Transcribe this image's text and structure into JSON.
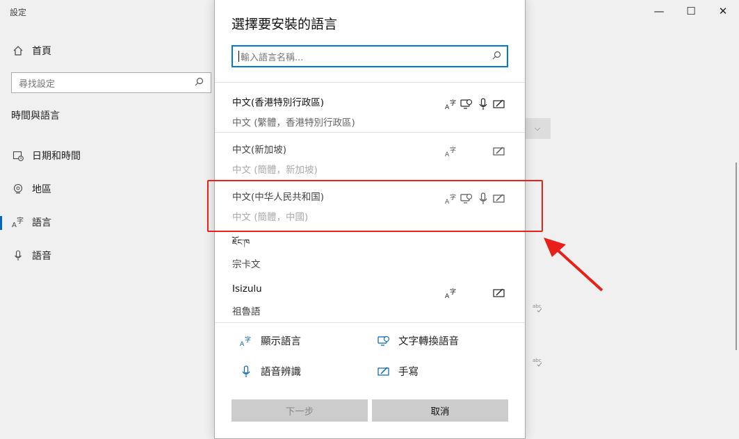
{
  "window": {
    "title": "設定",
    "minimize_glyph": "—",
    "maximize_glyph": "☐",
    "close_glyph": "✕"
  },
  "sidebar": {
    "home_label": "首頁",
    "search_placeholder": "尋找設定",
    "section_title": "時間與語言",
    "items": [
      {
        "label": "日期和時間",
        "icon": "calendar-clock-icon"
      },
      {
        "label": "地區",
        "icon": "globe-icon"
      },
      {
        "label": "語言",
        "icon": "language-icon",
        "selected": true
      },
      {
        "label": "語音",
        "icon": "microphone-icon"
      }
    ]
  },
  "dialog": {
    "title": "選擇要安裝的語言",
    "search_placeholder": "輸入語言名稱...",
    "languages": [
      {
        "name": "中文(香港特別行政區)",
        "subtitle": "中文 (繁體，香港特別行政區)",
        "features": [
          "display",
          "tts",
          "speech",
          "handwriting"
        ]
      },
      {
        "name": "中文(新加坡)",
        "subtitle": "中文 (簡體，新加坡)",
        "features": [
          "display",
          "handwriting"
        ]
      },
      {
        "name": "中文(中华人民共和国)",
        "subtitle": "中文 (簡體，中國)",
        "features": [
          "display",
          "tts",
          "speech",
          "handwriting"
        ],
        "highlighted": true
      },
      {
        "name": "ཇོང་ཁ",
        "subtitle": "宗卡文",
        "features": []
      },
      {
        "name": "Isizulu",
        "subtitle": "祖魯語",
        "features": [
          "display",
          "handwriting"
        ]
      }
    ],
    "legend": {
      "display": "顯示語言",
      "tts": "文字轉換語音",
      "speech": "語音辨識",
      "handwriting": "手寫"
    },
    "next_button": "下一步",
    "cancel_button": "取消"
  },
  "colors": {
    "accent": "#0078d7",
    "annotation": "#e8201a"
  }
}
